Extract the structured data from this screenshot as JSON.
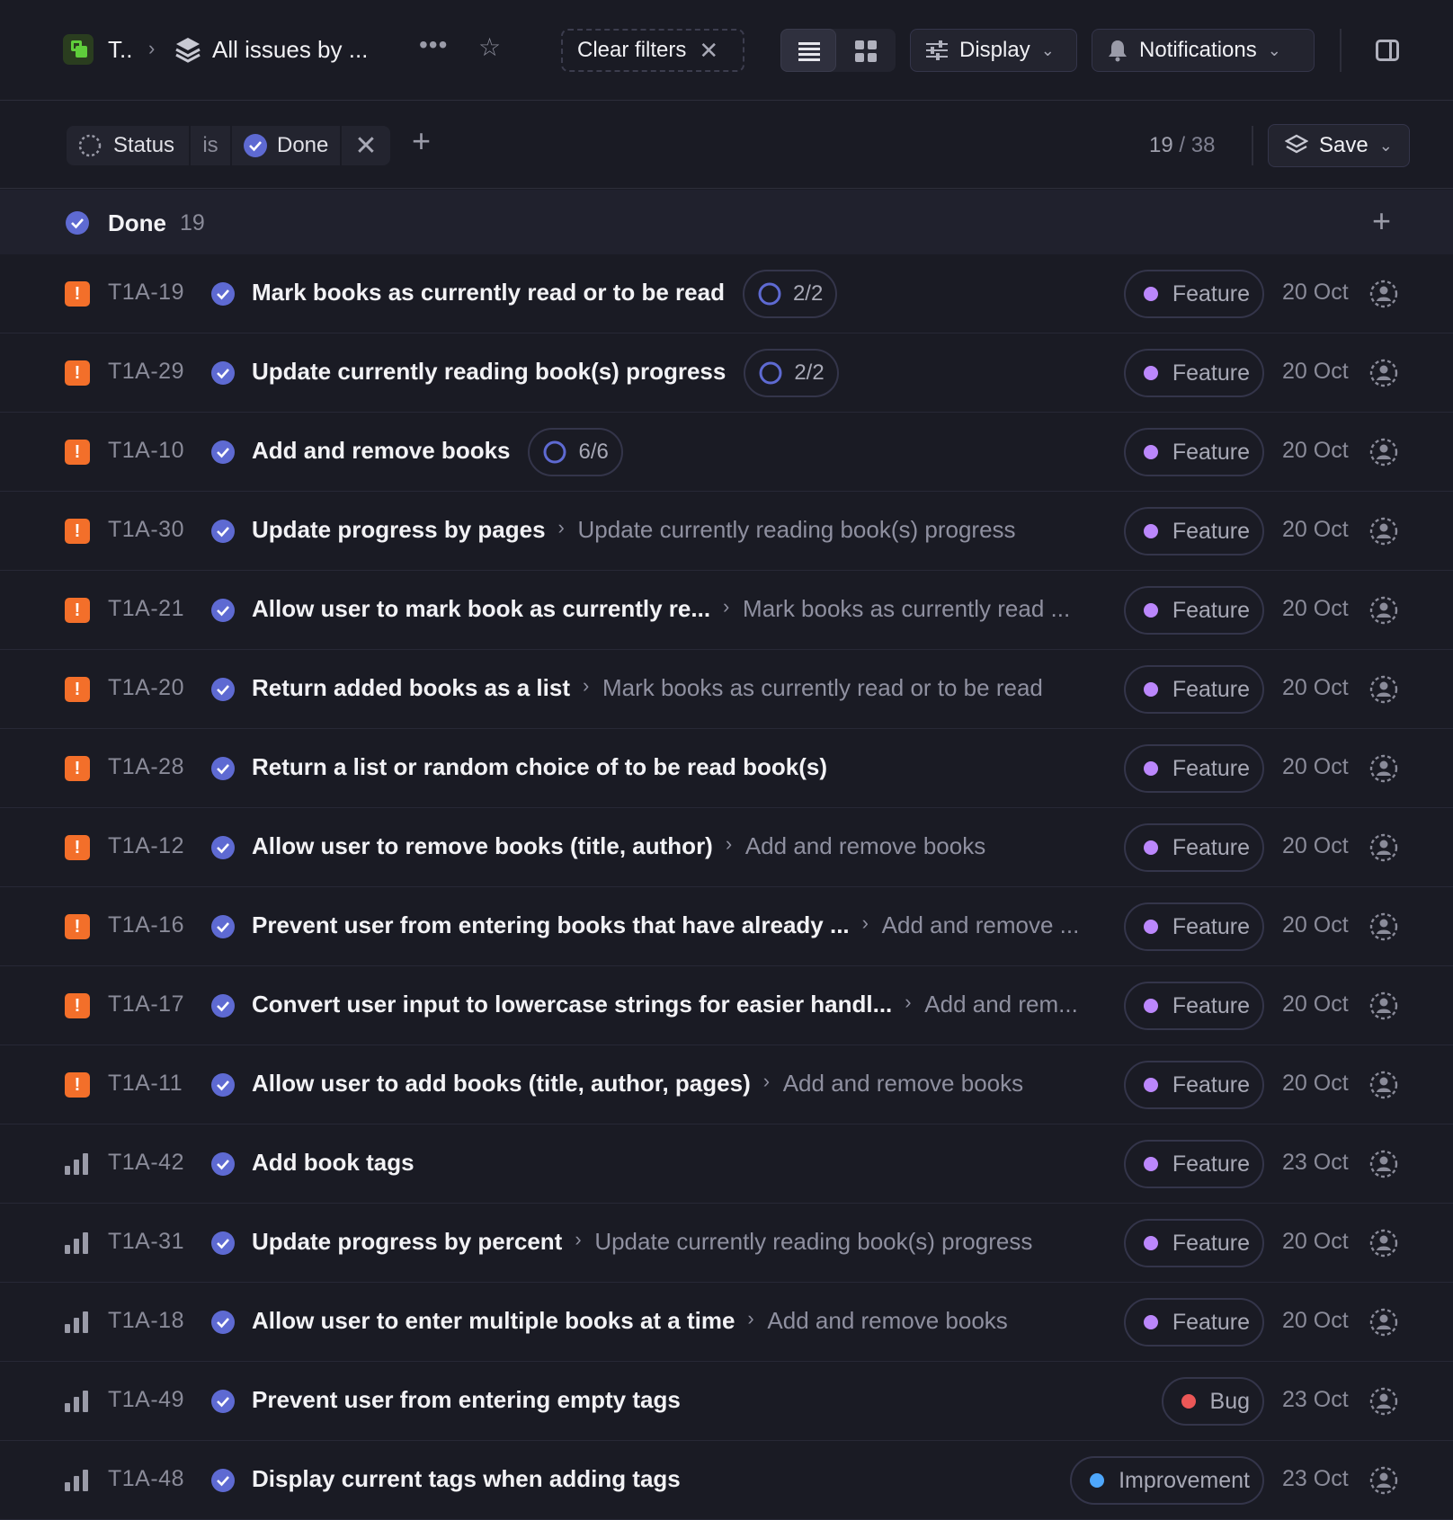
{
  "header": {
    "workspace_short": "T..",
    "view_title": "All issues by ...",
    "more_label": "•••",
    "clear_filters_label": "Clear filters",
    "display_label": "Display",
    "notifications_label": "Notifications"
  },
  "filter": {
    "field": "Status",
    "operator": "is",
    "value": "Done",
    "count_current": "19",
    "count_sep": "/",
    "count_total": "38",
    "save_label": "Save"
  },
  "group": {
    "title": "Done",
    "count": "19"
  },
  "colors": {
    "done": "#5e6ad2",
    "urgent": "#f36f2a",
    "feature": "#bb87fc",
    "bug": "#eb5757",
    "improvement": "#4ea7fc"
  },
  "issues": [
    {
      "priority": "urgent",
      "id": "T1A-19",
      "title": "Mark books as currently read or to be read",
      "parent": "",
      "sub": "2/2",
      "label": "Feature",
      "date": "20 Oct"
    },
    {
      "priority": "urgent",
      "id": "T1A-29",
      "title": "Update currently reading book(s) progress",
      "parent": "",
      "sub": "2/2",
      "label": "Feature",
      "date": "20 Oct"
    },
    {
      "priority": "urgent",
      "id": "T1A-10",
      "title": "Add and remove books",
      "parent": "",
      "sub": "6/6",
      "label": "Feature",
      "date": "20 Oct"
    },
    {
      "priority": "urgent",
      "id": "T1A-30",
      "title": "Update progress by pages",
      "parent": "Update currently reading book(s) progress",
      "sub": "",
      "label": "Feature",
      "date": "20 Oct"
    },
    {
      "priority": "urgent",
      "id": "T1A-21",
      "title": "Allow user to mark book as currently re...",
      "parent": "Mark books as currently read ...",
      "sub": "",
      "label": "Feature",
      "date": "20 Oct"
    },
    {
      "priority": "urgent",
      "id": "T1A-20",
      "title": "Return added books as a list",
      "parent": "Mark books as currently read or to be read",
      "sub": "",
      "label": "Feature",
      "date": "20 Oct"
    },
    {
      "priority": "urgent",
      "id": "T1A-28",
      "title": "Return a list or random choice of to be read book(s)",
      "parent": "",
      "sub": "",
      "label": "Feature",
      "date": "20 Oct"
    },
    {
      "priority": "urgent",
      "id": "T1A-12",
      "title": "Allow user to remove books (title, author)",
      "parent": "Add and remove books",
      "sub": "",
      "label": "Feature",
      "date": "20 Oct"
    },
    {
      "priority": "urgent",
      "id": "T1A-16",
      "title": "Prevent user from entering books that have already ...",
      "parent": "Add and remove ...",
      "sub": "",
      "label": "Feature",
      "date": "20 Oct"
    },
    {
      "priority": "urgent",
      "id": "T1A-17",
      "title": "Convert user input to lowercase strings for easier handl...",
      "parent": "Add and rem...",
      "sub": "",
      "label": "Feature",
      "date": "20 Oct"
    },
    {
      "priority": "urgent",
      "id": "T1A-11",
      "title": "Allow user to add books (title, author, pages)",
      "parent": "Add and remove books",
      "sub": "",
      "label": "Feature",
      "date": "20 Oct"
    },
    {
      "priority": "high",
      "id": "T1A-42",
      "title": "Add book tags",
      "parent": "",
      "sub": "",
      "label": "Feature",
      "date": "23 Oct"
    },
    {
      "priority": "high",
      "id": "T1A-31",
      "title": "Update progress by percent",
      "parent": "Update currently reading book(s) progress",
      "sub": "",
      "label": "Feature",
      "date": "20 Oct"
    },
    {
      "priority": "high",
      "id": "T1A-18",
      "title": "Allow user to enter multiple books at a time",
      "parent": "Add and remove books",
      "sub": "",
      "label": "Feature",
      "date": "20 Oct"
    },
    {
      "priority": "high",
      "id": "T1A-49",
      "title": "Prevent user from entering empty tags",
      "parent": "",
      "sub": "",
      "label": "Bug",
      "date": "23 Oct"
    },
    {
      "priority": "high",
      "id": "T1A-48",
      "title": "Display current tags when adding tags",
      "parent": "",
      "sub": "",
      "label": "Improvement",
      "date": "23 Oct"
    }
  ]
}
